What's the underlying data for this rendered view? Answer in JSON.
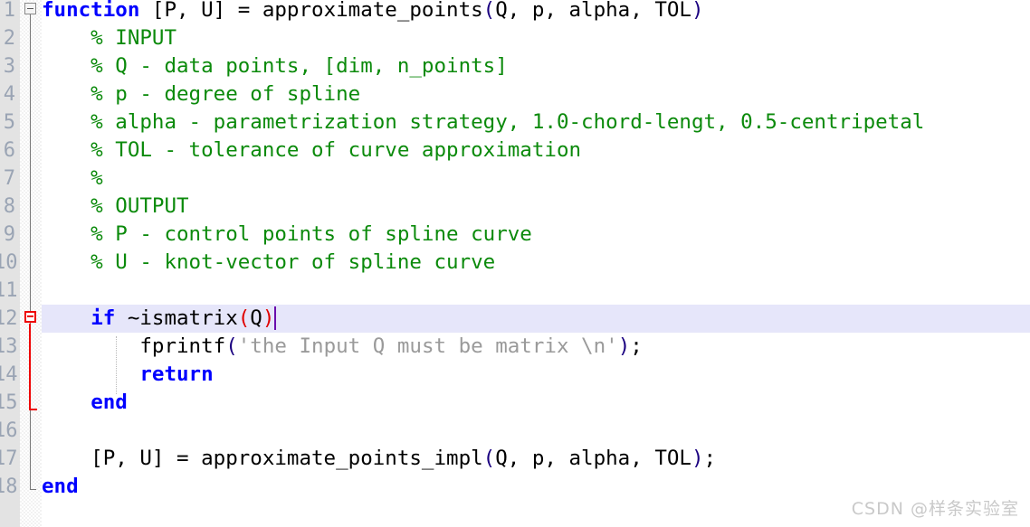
{
  "editor": {
    "language": "MATLAB",
    "gutter_bg": "#e3e3e3",
    "background": "#ffffff",
    "highlight_color": "#e6e6fa",
    "caret_color": "#6a0dad",
    "line_height": 31,
    "first_visible_line": 1
  },
  "line_numbers": [
    "1",
    "2",
    "3",
    "4",
    "5",
    "6",
    "7",
    "8",
    "9",
    "10",
    "11",
    "12",
    "13",
    "14",
    "15",
    "16",
    "17",
    "18"
  ],
  "fold_markers": [
    {
      "line": 1,
      "state": "expanded",
      "color": "#8a8a8a",
      "name": "fold-marker-function"
    },
    {
      "line": 12,
      "state": "expanded",
      "color": "#ee0000",
      "name": "fold-marker-if"
    }
  ],
  "colors": {
    "keyword": "#0000ff",
    "comment": "#0b8a0b",
    "string": "#9a9a9a",
    "plain": "#000000",
    "paren": "#1a0080",
    "matched_paren": "#e00000",
    "linenumber": "#9aa4b4",
    "watermark": "#c9c9c9"
  },
  "lines": [
    {
      "number": "1",
      "highlighted": false,
      "tokens": [
        {
          "t": "function",
          "c": "kw"
        },
        {
          "t": " [P, U] = approximate_points",
          "c": "plain"
        },
        {
          "t": "(",
          "c": "paren"
        },
        {
          "t": "Q, p, alpha, TOL",
          "c": "plain"
        },
        {
          "t": ")",
          "c": "paren"
        }
      ]
    },
    {
      "number": "2",
      "highlighted": false,
      "tokens": [
        {
          "t": "    % INPUT",
          "c": "comment"
        }
      ]
    },
    {
      "number": "3",
      "highlighted": false,
      "tokens": [
        {
          "t": "    % Q - data points, [dim, n_points]",
          "c": "comment"
        }
      ]
    },
    {
      "number": "4",
      "highlighted": false,
      "tokens": [
        {
          "t": "    % p - degree of spline",
          "c": "comment"
        }
      ]
    },
    {
      "number": "5",
      "highlighted": false,
      "tokens": [
        {
          "t": "    % alpha - parametrization strategy, 1.0-chord-lengt, 0.5-centripetal",
          "c": "comment"
        }
      ]
    },
    {
      "number": "6",
      "highlighted": false,
      "tokens": [
        {
          "t": "    % TOL - tolerance of curve approximation",
          "c": "comment"
        }
      ]
    },
    {
      "number": "7",
      "highlighted": false,
      "tokens": [
        {
          "t": "    %",
          "c": "comment"
        }
      ]
    },
    {
      "number": "8",
      "highlighted": false,
      "tokens": [
        {
          "t": "    % OUTPUT",
          "c": "comment"
        }
      ]
    },
    {
      "number": "9",
      "highlighted": false,
      "tokens": [
        {
          "t": "    % P - control points of spline curve",
          "c": "comment"
        }
      ]
    },
    {
      "number": "10",
      "highlighted": false,
      "tokens": [
        {
          "t": "    % U - knot-vector of spline curve",
          "c": "comment"
        }
      ]
    },
    {
      "number": "11",
      "highlighted": false,
      "tokens": [
        {
          "t": "",
          "c": "plain"
        }
      ]
    },
    {
      "number": "12",
      "highlighted": true,
      "caret_after": true,
      "tokens": [
        {
          "t": "    ",
          "c": "plain"
        },
        {
          "t": "if",
          "c": "kw"
        },
        {
          "t": " ~ismatrix",
          "c": "plain"
        },
        {
          "t": "(",
          "c": "mparen"
        },
        {
          "t": "Q",
          "c": "plain"
        },
        {
          "t": ")",
          "c": "mparen"
        }
      ]
    },
    {
      "number": "13",
      "highlighted": false,
      "tokens": [
        {
          "t": "        fprintf",
          "c": "plain"
        },
        {
          "t": "(",
          "c": "paren"
        },
        {
          "t": "'the Input Q must be matrix \\n'",
          "c": "str"
        },
        {
          "t": ")",
          "c": "paren"
        },
        {
          "t": ";",
          "c": "plain"
        }
      ]
    },
    {
      "number": "14",
      "highlighted": false,
      "tokens": [
        {
          "t": "        ",
          "c": "plain"
        },
        {
          "t": "return",
          "c": "kw"
        }
      ]
    },
    {
      "number": "15",
      "highlighted": false,
      "tokens": [
        {
          "t": "    ",
          "c": "plain"
        },
        {
          "t": "end",
          "c": "kw"
        }
      ]
    },
    {
      "number": "16",
      "highlighted": false,
      "tokens": [
        {
          "t": "",
          "c": "plain"
        }
      ]
    },
    {
      "number": "17",
      "highlighted": false,
      "tokens": [
        {
          "t": "    [P, U] = approximate_points_impl",
          "c": "plain"
        },
        {
          "t": "(",
          "c": "paren"
        },
        {
          "t": "Q, p, alpha, TOL",
          "c": "plain"
        },
        {
          "t": ")",
          "c": "paren"
        },
        {
          "t": ";",
          "c": "plain"
        }
      ]
    },
    {
      "number": "18",
      "highlighted": false,
      "tokens": [
        {
          "t": "end",
          "c": "kw"
        }
      ]
    }
  ],
  "watermark": {
    "text": "CSDN @样条实验室"
  }
}
